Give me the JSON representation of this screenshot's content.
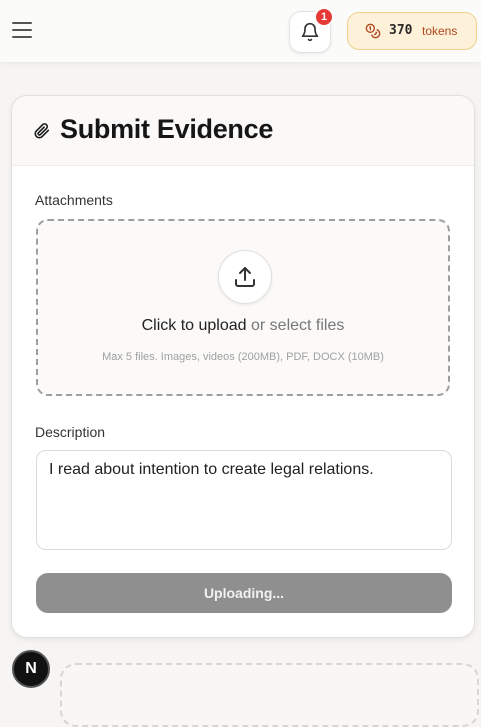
{
  "header": {
    "notification_count": "1",
    "tokens_count": "370",
    "tokens_label": "tokens"
  },
  "card": {
    "title": "Submit Evidence",
    "attachments_label": "Attachments",
    "dropzone": {
      "primary": "Click to upload",
      "secondary": " or select files",
      "hint": "Max 5 files. Images, videos (200MB), PDF, DOCX (10MB)"
    },
    "description_label": "Description",
    "description_value": "I read about intention to create legal relations.",
    "submit_label": "Uploading..."
  },
  "avatar": {
    "initial": "N"
  },
  "icons": {
    "menu": "hamburger-icon",
    "bell": "bell-icon",
    "tokens": "coins-icon",
    "title": "paperclip-icon",
    "upload": "upload-icon"
  },
  "colors": {
    "accent_orange": "#b2461e",
    "badge_red": "#e53935",
    "disabled_button": "#8f8f8f"
  }
}
